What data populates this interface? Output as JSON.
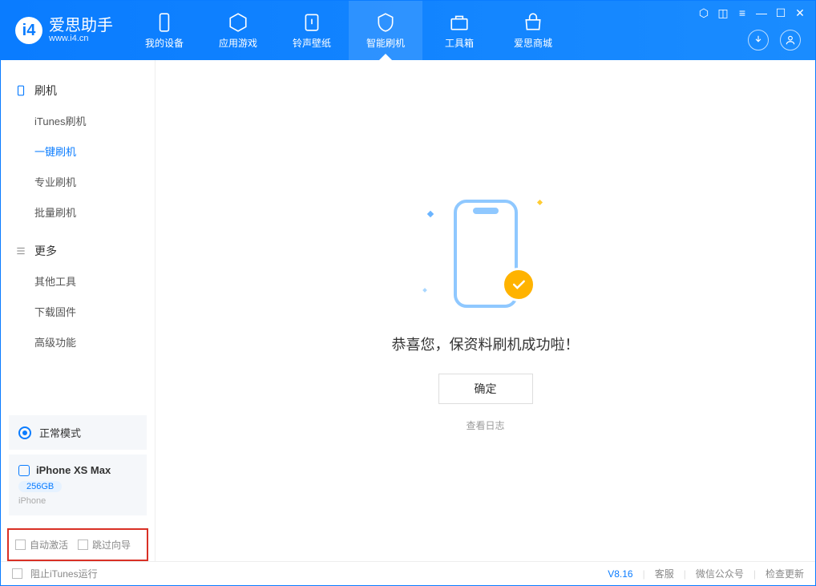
{
  "app": {
    "title": "爱思助手",
    "subtitle": "www.i4.cn"
  },
  "header_tabs": [
    {
      "label": "我的设备"
    },
    {
      "label": "应用游戏"
    },
    {
      "label": "铃声壁纸"
    },
    {
      "label": "智能刷机",
      "active": true
    },
    {
      "label": "工具箱"
    },
    {
      "label": "爱思商城"
    }
  ],
  "sidebar": {
    "section_flash": {
      "title": "刷机",
      "items": [
        "iTunes刷机",
        "一键刷机",
        "专业刷机",
        "批量刷机"
      ],
      "active_index": 1
    },
    "section_more": {
      "title": "更多",
      "items": [
        "其他工具",
        "下载固件",
        "高级功能"
      ]
    },
    "mode_label": "正常模式",
    "device": {
      "name": "iPhone XS Max",
      "storage": "256GB",
      "type": "iPhone"
    },
    "checks": {
      "auto_activate": "自动激活",
      "skip_guide": "跳过向导"
    }
  },
  "main": {
    "success_message": "恭喜您，保资料刷机成功啦！",
    "ok_button": "确定",
    "view_log": "查看日志"
  },
  "footer": {
    "block_itunes": "阻止iTunes运行",
    "version": "V8.16",
    "links": [
      "客服",
      "微信公众号",
      "检查更新"
    ]
  }
}
